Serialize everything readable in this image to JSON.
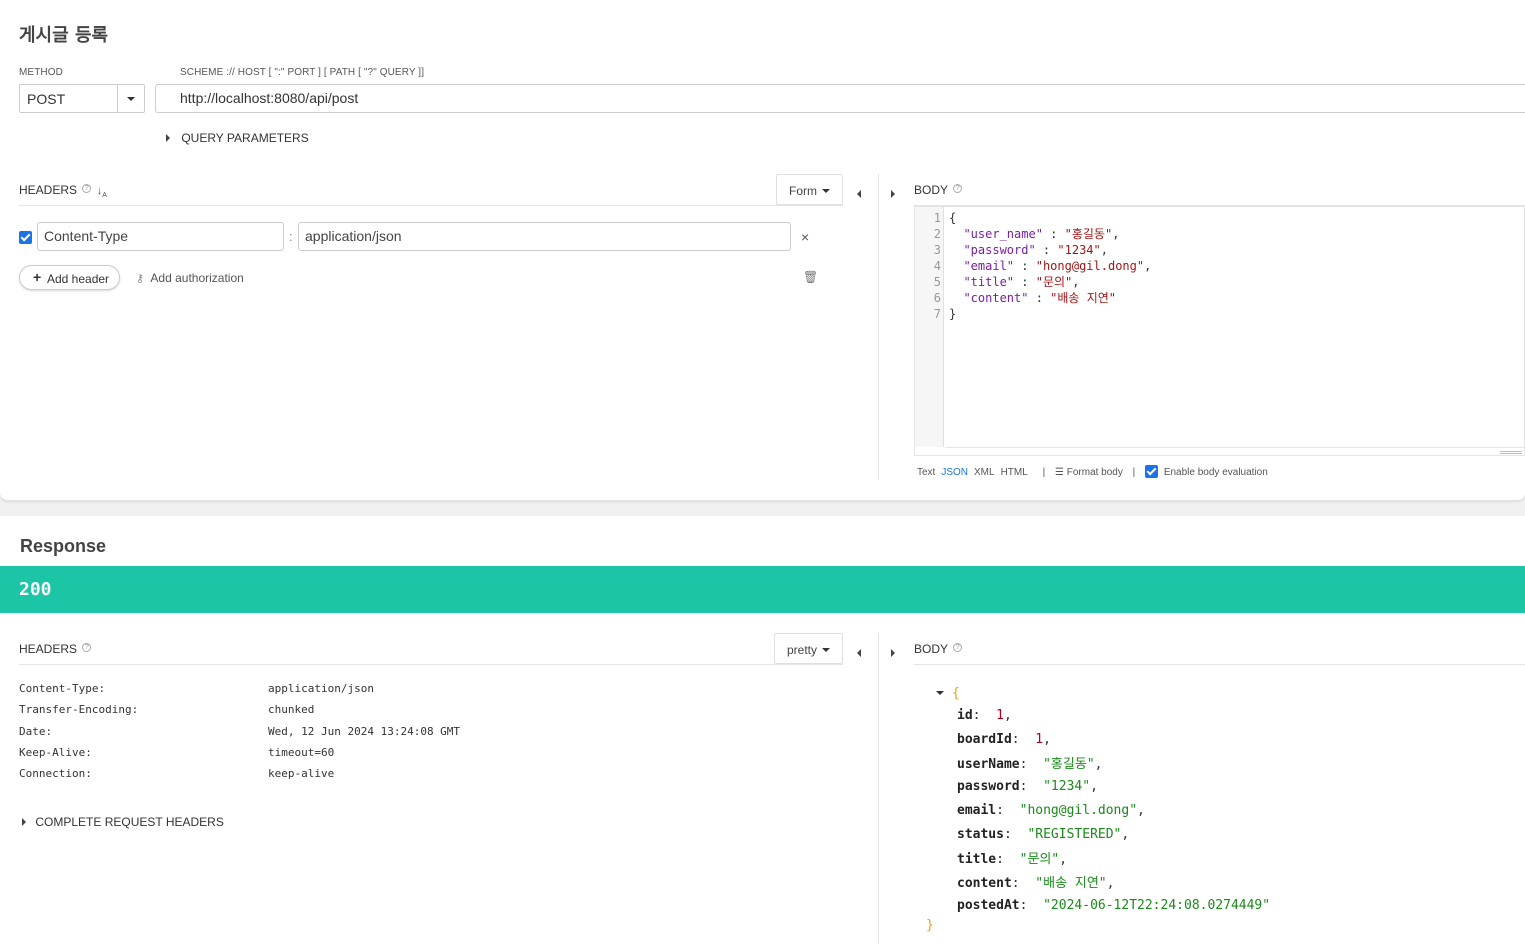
{
  "request": {
    "title": "게시글 등록",
    "method_label": "METHOD",
    "method_value": "POST",
    "url_label": "SCHEME :// HOST [ \":\" PORT ] [ PATH [ \"?\" QUERY ]]",
    "url_value": "http://localhost:8080/api/post",
    "query_params_label": "QUERY PARAMETERS",
    "headers_label": "HEADERS",
    "headers_mode": "Form",
    "header_rows": [
      {
        "key": "Content-Type",
        "value": "application/json",
        "separator": ":"
      }
    ],
    "add_header_label": "Add header",
    "add_auth_label": "Add authorization",
    "body_label": "BODY",
    "body_lines": [
      {
        "n": "1",
        "text": "{"
      },
      {
        "n": "2",
        "key": "\"user_name\"",
        "sep": " : ",
        "val": "\"홍길동\"",
        "end": ","
      },
      {
        "n": "3",
        "key": "\"password\"",
        "sep": " : ",
        "val": "\"1234\"",
        "end": ","
      },
      {
        "n": "4",
        "key": "\"email\"",
        "sep": " : ",
        "val": "\"hong@gil.dong\"",
        "end": ","
      },
      {
        "n": "5",
        "key": "\"title\"",
        "sep": " : ",
        "val": "\"문의\"",
        "end": ","
      },
      {
        "n": "6",
        "key": "\"content\"",
        "sep": " : ",
        "val": "\"배송 지연\"",
        "end": ""
      },
      {
        "n": "7",
        "text": "}"
      }
    ],
    "format_options": [
      "Text",
      "JSON",
      "XML",
      "HTML"
    ],
    "format_active": "JSON",
    "format_body_label": "Format body",
    "enable_eval_label": "Enable body evaluation",
    "separator": "|"
  },
  "response": {
    "title": "Response",
    "status_code": "200",
    "status_color": "#1cc5a6",
    "headers_label": "HEADERS",
    "headers_mode": "pretty",
    "header_rows": [
      {
        "key": "Content-Type:",
        "value": "application/json"
      },
      {
        "key": "Transfer-Encoding:",
        "value": "chunked"
      },
      {
        "key": "Date:",
        "value": "Wed, 12 Jun 2024 13:24:08 GMT"
      },
      {
        "key": "Keep-Alive:",
        "value": "timeout=60"
      },
      {
        "key": "Connection:",
        "value": "keep-alive"
      }
    ],
    "complete_headers_label": "COMPLETE REQUEST HEADERS",
    "body_label": "BODY",
    "open_brace": "{",
    "close_brace": "}",
    "body_fields": [
      {
        "key": "id",
        "value": "1",
        "type": "number"
      },
      {
        "key": "boardId",
        "value": "1",
        "type": "number"
      },
      {
        "key": "userName",
        "value": "\"홍길동\"",
        "type": "string"
      },
      {
        "key": "password",
        "value": "\"1234\"",
        "type": "string"
      },
      {
        "key": "email",
        "value": "\"hong@gil.dong\"",
        "type": "string"
      },
      {
        "key": "status",
        "value": "\"REGISTERED\"",
        "type": "string"
      },
      {
        "key": "title",
        "value": "\"문의\"",
        "type": "string"
      },
      {
        "key": "content",
        "value": "\"배송 지연\"",
        "type": "string"
      },
      {
        "key": "postedAt",
        "value": "\"2024-06-12T22:24:08.0274449\"",
        "type": "string"
      }
    ]
  }
}
